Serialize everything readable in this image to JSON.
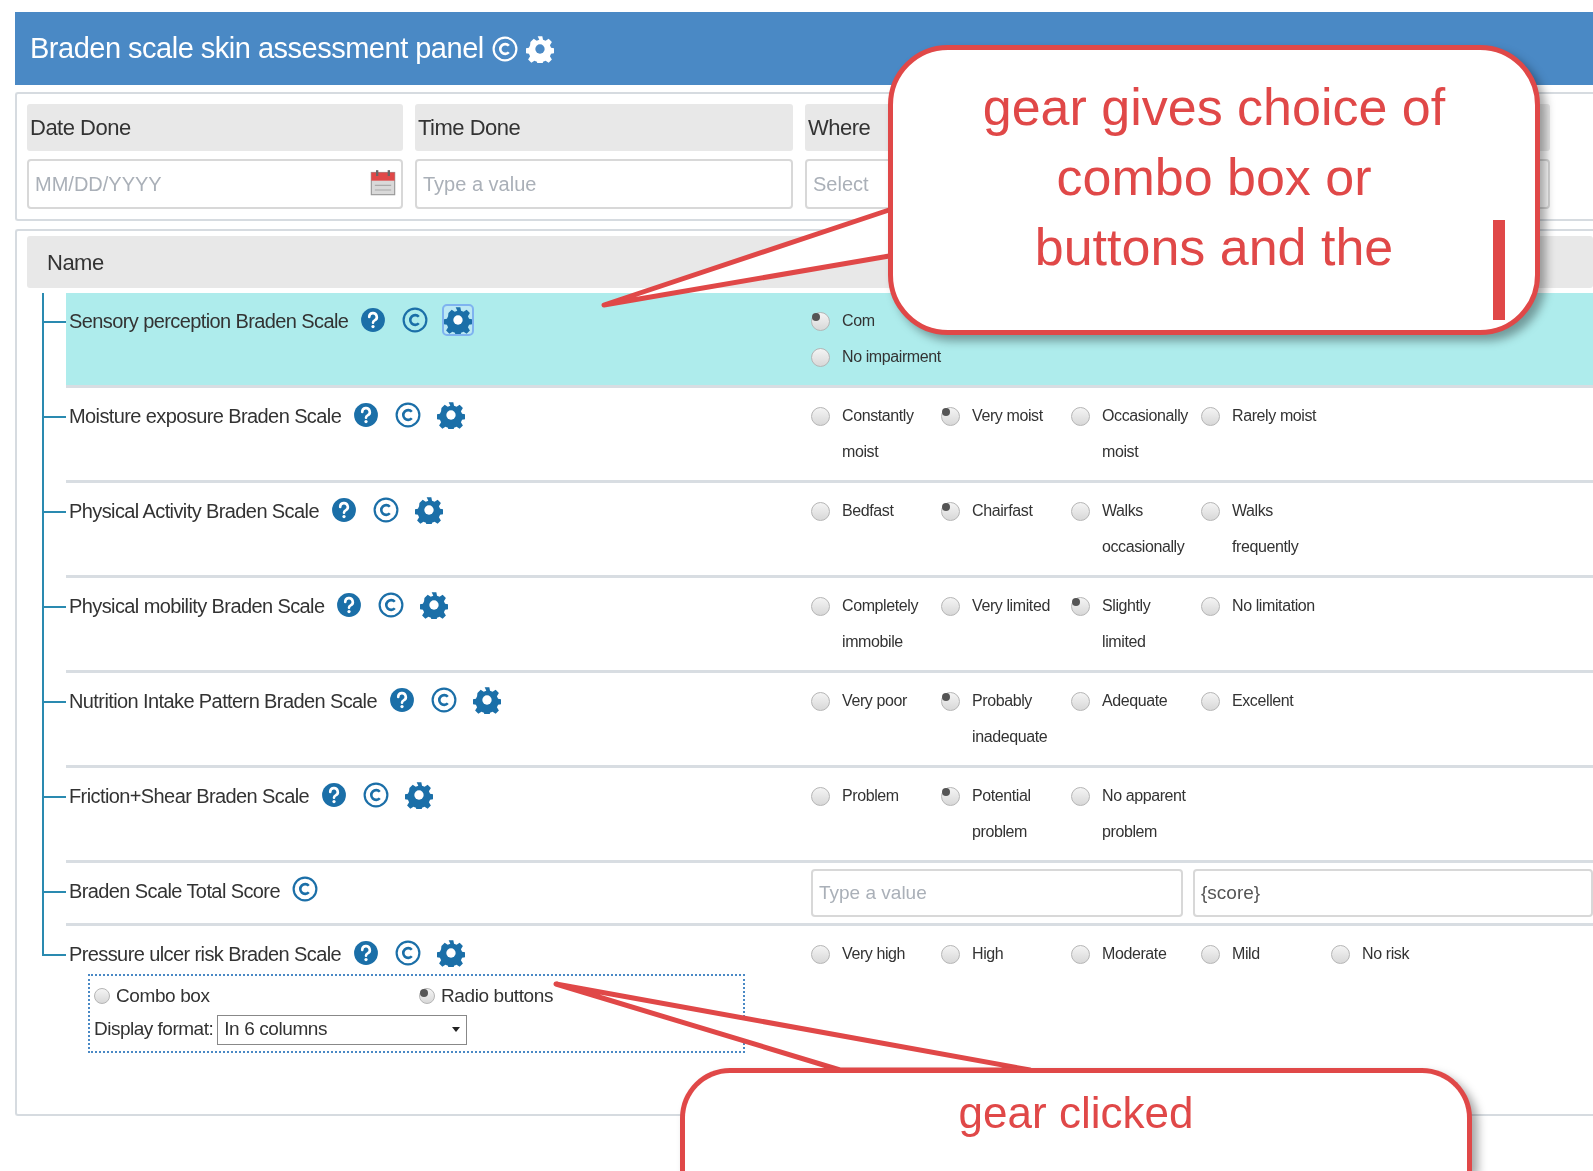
{
  "panel": {
    "title": "Braden scale skin assessment panel"
  },
  "header_fields": [
    {
      "label": "Date Done",
      "placeholder": "MM/DD/YYYY",
      "kind": "date"
    },
    {
      "label": "Time Done",
      "placeholder": "Type a value",
      "kind": "text"
    },
    {
      "label": "Where",
      "placeholder": "Select",
      "kind": "select"
    }
  ],
  "table": {
    "columns": [
      "Name"
    ],
    "rows": [
      {
        "name": "Sensory perception Braden Scale",
        "kind": "list",
        "selected": true,
        "gear_focused": true,
        "options": [
          {
            "label": "Com",
            "selected": true
          },
          {
            "label": "No impairment",
            "selected": false
          }
        ]
      },
      {
        "name": "Moisture exposure Braden Scale",
        "kind": "radio",
        "selected": false,
        "gear_focused": false,
        "options": [
          {
            "label": "Constantly moist",
            "selected": false
          },
          {
            "label": "Very moist",
            "selected": true
          },
          {
            "label": "Occasionally moist",
            "selected": false
          },
          {
            "label": "Rarely moist",
            "selected": false
          }
        ]
      },
      {
        "name": "Physical Activity Braden Scale",
        "kind": "radio",
        "selected": false,
        "gear_focused": false,
        "options": [
          {
            "label": "Bedfast",
            "selected": false
          },
          {
            "label": "Chairfast",
            "selected": true
          },
          {
            "label": "Walks occasionally",
            "selected": false
          },
          {
            "label": "Walks frequently",
            "selected": false
          }
        ]
      },
      {
        "name": "Physical mobility Braden Scale",
        "kind": "radio",
        "selected": false,
        "gear_focused": false,
        "options": [
          {
            "label": "Completely immobile",
            "selected": false
          },
          {
            "label": "Very limited",
            "selected": false
          },
          {
            "label": "Slightly limited",
            "selected": true
          },
          {
            "label": "No limitation",
            "selected": false
          }
        ]
      },
      {
        "name": "Nutrition Intake Pattern Braden Scale",
        "kind": "radio",
        "selected": false,
        "gear_focused": false,
        "options": [
          {
            "label": "Very poor",
            "selected": false
          },
          {
            "label": "Probably inadequate",
            "selected": true
          },
          {
            "label": "Adequate",
            "selected": false
          },
          {
            "label": "Excellent",
            "selected": false
          }
        ]
      },
      {
        "name": "Friction+Shear Braden Scale",
        "kind": "radio",
        "selected": false,
        "gear_focused": false,
        "options": [
          {
            "label": "Problem",
            "selected": false
          },
          {
            "label": "Potential problem",
            "selected": true
          },
          {
            "label": "No apparent problem",
            "selected": false
          }
        ]
      },
      {
        "name": "Braden Scale Total Score",
        "kind": "score",
        "selected": false,
        "placeholder": "Type a value",
        "value": "{score}"
      },
      {
        "name": "Pressure ulcer risk Braden Scale",
        "kind": "radio",
        "selected": false,
        "gear_focused": false,
        "options": [
          {
            "label": "Very high",
            "selected": false
          },
          {
            "label": "High",
            "selected": false
          },
          {
            "label": "Moderate",
            "selected": false
          },
          {
            "label": "Mild",
            "selected": false
          },
          {
            "label": "No risk",
            "selected": false
          }
        ],
        "gear_menu": {
          "options": [
            {
              "label": "Combo box",
              "selected": false
            },
            {
              "label": "Radio buttons",
              "selected": true
            }
          ],
          "format_label": "Display format:",
          "format_value": "In 6 columns"
        }
      }
    ]
  },
  "callouts": [
    {
      "text": "gear gives choice of combo box or buttons and the"
    },
    {
      "text": "gear clicked"
    }
  ]
}
